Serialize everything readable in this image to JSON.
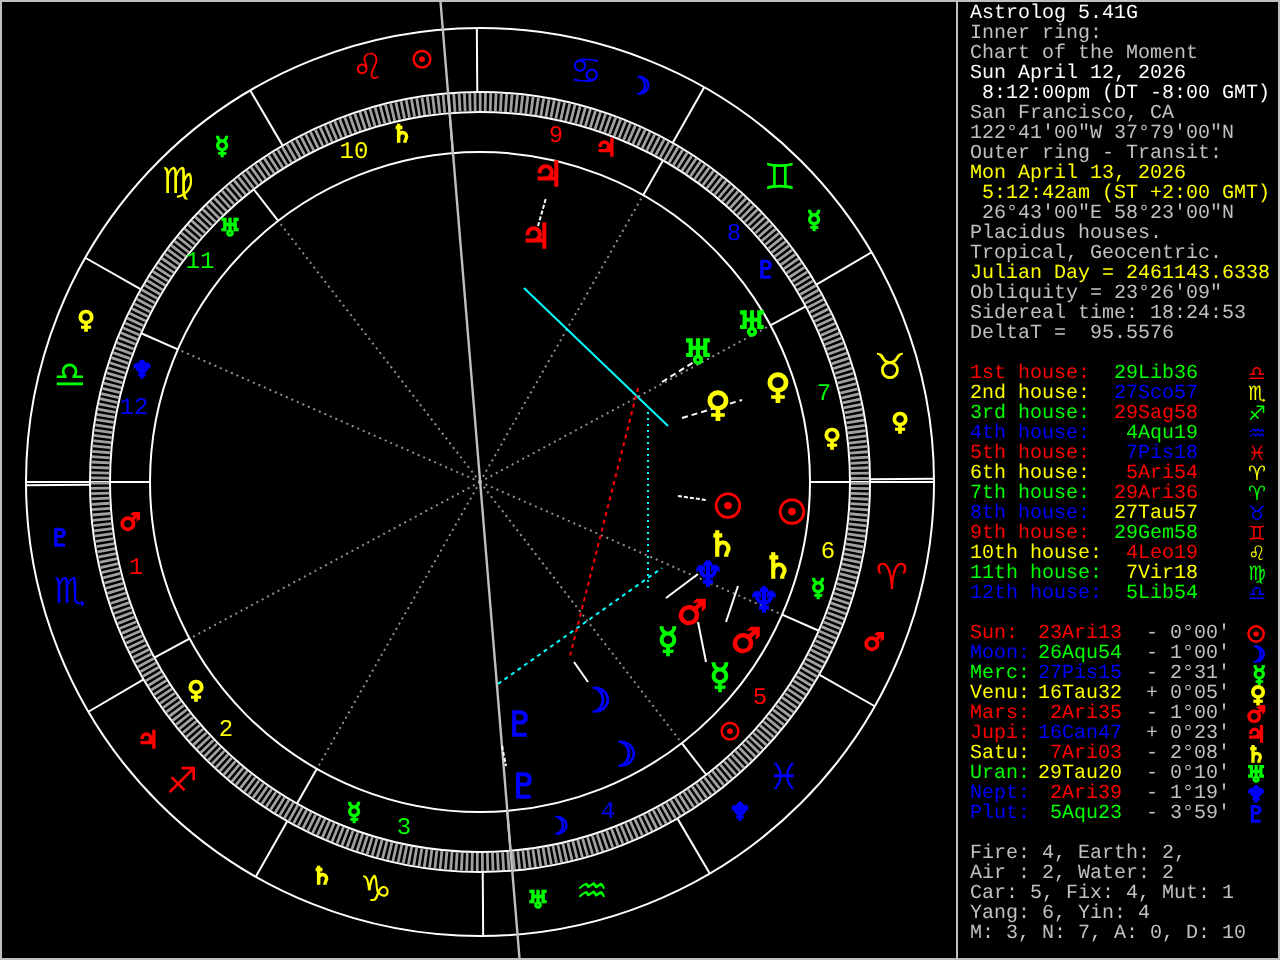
{
  "chart": {
    "house_numbers": [
      {
        "label": "1",
        "color": "#ff0000"
      },
      {
        "label": "2",
        "color": "#ffff00"
      },
      {
        "label": "3",
        "color": "#00ff00"
      },
      {
        "label": "4",
        "color": "#0000ff"
      },
      {
        "label": "5",
        "color": "#ff0000"
      },
      {
        "label": "6",
        "color": "#ffff00"
      },
      {
        "label": "7",
        "color": "#00ff00"
      },
      {
        "label": "8",
        "color": "#0000ff"
      },
      {
        "label": "9",
        "color": "#ff0000"
      },
      {
        "label": "10",
        "color": "#ffff00"
      },
      {
        "label": "11",
        "color": "#00ff00"
      },
      {
        "label": "12",
        "color": "#0000ff"
      }
    ],
    "sign_glyphs": [
      {
        "glyph": "♈",
        "color": "#ff0000"
      },
      {
        "glyph": "♉",
        "color": "#ffff00"
      },
      {
        "glyph": "♊",
        "color": "#00ff00"
      },
      {
        "glyph": "♋",
        "color": "#0000ff"
      },
      {
        "glyph": "♌",
        "color": "#ff0000"
      },
      {
        "glyph": "♍",
        "color": "#ffff00"
      },
      {
        "glyph": "♎",
        "color": "#00ff00"
      },
      {
        "glyph": "♏",
        "color": "#0000ff"
      },
      {
        "glyph": "♐",
        "color": "#ff0000"
      },
      {
        "glyph": "♑",
        "color": "#ffff00"
      },
      {
        "glyph": "♒",
        "color": "#00ff00"
      },
      {
        "glyph": "♓",
        "color": "#0000ff"
      }
    ],
    "planet_glyphs": [
      {
        "glyph": "☉",
        "color": "#ff0000"
      },
      {
        "glyph": "☿",
        "color": "#00ff00"
      },
      {
        "glyph": "♀",
        "color": "#ffff00"
      },
      {
        "glyph": "☽",
        "color": "#0000ff"
      },
      {
        "glyph": "☿",
        "color": "#00ff00"
      },
      {
        "glyph": "♀",
        "color": "#ffff00"
      },
      {
        "glyph": "♂",
        "color": "#ff0000"
      },
      {
        "glyph": "♇",
        "color": "#0000ff"
      },
      {
        "glyph": "♃",
        "color": "#ff0000"
      },
      {
        "glyph": "♄",
        "color": "#ffff00"
      },
      {
        "glyph": "♅",
        "color": "#00ff00"
      },
      {
        "glyph": "♆",
        "color": "#0000ff"
      },
      {
        "glyph": "♂",
        "color": "#ff0000"
      },
      {
        "glyph": "♄",
        "color": "#ffff00"
      },
      {
        "glyph": "♅",
        "color": "#00ff00"
      },
      {
        "glyph": "♆",
        "color": "#0000ff"
      },
      {
        "glyph": "♃",
        "color": "#ff0000"
      },
      {
        "glyph": "♇",
        "color": "#0000ff"
      },
      {
        "glyph": "♀",
        "color": "#ffff00"
      },
      {
        "glyph": "♀",
        "color": "#ffff00"
      },
      {
        "glyph": "☿",
        "color": "#00ff00"
      },
      {
        "glyph": "☽",
        "color": "#0000ff"
      },
      {
        "glyph": "☉",
        "color": "#ff0000"
      },
      {
        "glyph": "☿",
        "color": "#00ff00"
      },
      {
        "glyph": "♃",
        "color": "#ff0000"
      },
      {
        "glyph": "♃",
        "color": "#ff0000"
      },
      {
        "glyph": "♅",
        "color": "#00ff00"
      },
      {
        "glyph": "♅",
        "color": "#00ff00"
      },
      {
        "glyph": "♀",
        "color": "#ffff00"
      },
      {
        "glyph": "♀",
        "color": "#ffff00"
      },
      {
        "glyph": "☉",
        "color": "#ff0000"
      },
      {
        "glyph": "☉",
        "color": "#ff0000"
      },
      {
        "glyph": "♄",
        "color": "#ffff00"
      },
      {
        "glyph": "♄",
        "color": "#ffff00"
      },
      {
        "glyph": "♆",
        "color": "#0000ff"
      },
      {
        "glyph": "♆",
        "color": "#0000ff"
      },
      {
        "glyph": "♂",
        "color": "#ff0000"
      },
      {
        "glyph": "☿",
        "color": "#00ff00"
      },
      {
        "glyph": "♂",
        "color": "#ff0000"
      },
      {
        "glyph": "☿",
        "color": "#00ff00"
      },
      {
        "glyph": "☽",
        "color": "#0000ff"
      },
      {
        "glyph": "☽",
        "color": "#0000ff"
      },
      {
        "glyph": "♇",
        "color": "#0000ff"
      },
      {
        "glyph": "♇",
        "color": "#0000ff"
      }
    ]
  },
  "info_lines": [
    {
      "text": "Astrolog 5.41G",
      "color": "#ffffff"
    },
    {
      "text": "Inner ring:",
      "color": "#c0c0c0"
    },
    {
      "text": "Chart of the Moment",
      "color": "#c0c0c0"
    },
    {
      "text": "Sun April 12, 2026",
      "color": "#ffffff"
    },
    {
      "text": " 8:12:00pm (DT -8:00 GMT)",
      "color": "#ffffff"
    },
    {
      "text": "San Francisco, CA",
      "color": "#c0c0c0"
    },
    {
      "text": "122°41'00\"W 37°79'00\"N",
      "color": "#c0c0c0"
    },
    {
      "text": "Outer ring - Transit:",
      "color": "#c0c0c0"
    },
    {
      "text": "Mon April 13, 2026",
      "color": "#ffff00"
    },
    {
      "text": " 5:12:42am (ST +2:00 GMT)",
      "color": "#ffff00"
    },
    {
      "text": " 26°43'00\"E 58°23'00\"N",
      "color": "#c0c0c0"
    },
    {
      "text": "Placidus houses.",
      "color": "#c0c0c0"
    },
    {
      "text": "Tropical, Geocentric.",
      "color": "#c0c0c0"
    },
    {
      "text": "Julian Day = 2461143.6338",
      "color": "#ffff00"
    },
    {
      "text": "Obliquity = 23°26'09\"",
      "color": "#c0c0c0"
    },
    {
      "text": "Sidereal time: 18:24:53",
      "color": "#c0c0c0"
    },
    {
      "text": "DeltaT =  95.5576",
      "color": "#c0c0c0"
    }
  ],
  "houses": [
    {
      "label": {
        "text": "1st house:",
        "color": "#ff0000"
      },
      "position": {
        "text": "29Lib36",
        "color": "#00ff00"
      },
      "glyph": {
        "text": "♎",
        "color": "#ff0000"
      }
    },
    {
      "label": {
        "text": "2nd house:",
        "color": "#ffff00"
      },
      "position": {
        "text": "27Sco57",
        "color": "#0000ff"
      },
      "glyph": {
        "text": "♏",
        "color": "#ffff00"
      }
    },
    {
      "label": {
        "text": "3rd house:",
        "color": "#00ff00"
      },
      "position": {
        "text": "29Sag58",
        "color": "#ff0000"
      },
      "glyph": {
        "text": "♐",
        "color": "#00ff00"
      }
    },
    {
      "label": {
        "text": "4th house:",
        "color": "#0000ff"
      },
      "position": {
        "text": "4Aqu19",
        "color": "#00ff00"
      },
      "glyph": {
        "text": "♒",
        "color": "#0000ff"
      }
    },
    {
      "label": {
        "text": "5th house:",
        "color": "#ff0000"
      },
      "position": {
        "text": "7Pis18",
        "color": "#0000ff"
      },
      "glyph": {
        "text": "♓",
        "color": "#ff0000"
      }
    },
    {
      "label": {
        "text": "6th house:",
        "color": "#ffff00"
      },
      "position": {
        "text": "5Ari54",
        "color": "#ff0000"
      },
      "glyph": {
        "text": "♈",
        "color": "#ffff00"
      }
    },
    {
      "label": {
        "text": "7th house:",
        "color": "#00ff00"
      },
      "position": {
        "text": "29Ari36",
        "color": "#ff0000"
      },
      "glyph": {
        "text": "♈",
        "color": "#00ff00"
      }
    },
    {
      "label": {
        "text": "8th house:",
        "color": "#0000ff"
      },
      "position": {
        "text": "27Tau57",
        "color": "#ffff00"
      },
      "glyph": {
        "text": "♉",
        "color": "#0000ff"
      }
    },
    {
      "label": {
        "text": "9th house:",
        "color": "#ff0000"
      },
      "position": {
        "text": "29Gem58",
        "color": "#00ff00"
      },
      "glyph": {
        "text": "♊",
        "color": "#ff0000"
      }
    },
    {
      "label": {
        "text": "10th house:",
        "color": "#ffff00"
      },
      "position": {
        "text": "4Leo19",
        "color": "#ff0000"
      },
      "glyph": {
        "text": "♌",
        "color": "#ffff00"
      }
    },
    {
      "label": {
        "text": "11th house:",
        "color": "#00ff00"
      },
      "position": {
        "text": "7Vir18",
        "color": "#ffff00"
      },
      "glyph": {
        "text": "♍",
        "color": "#00ff00"
      }
    },
    {
      "label": {
        "text": "12th house:",
        "color": "#0000ff"
      },
      "position": {
        "text": "5Lib54",
        "color": "#00ff00"
      },
      "glyph": {
        "text": "♎",
        "color": "#0000ff"
      }
    }
  ],
  "planets": [
    {
      "name": {
        "text": "Sun:",
        "color": "#ff0000"
      },
      "position": {
        "text": "23Ari13",
        "color": "#ff0000"
      },
      "motion": "- 0°00'",
      "glyph": {
        "text": "☉",
        "color": "#ff0000"
      }
    },
    {
      "name": {
        "text": "Moon:",
        "color": "#0000ff"
      },
      "position": {
        "text": "26Aqu54",
        "color": "#00ff00"
      },
      "motion": "- 1°00'",
      "glyph": {
        "text": "☽",
        "color": "#0000ff"
      }
    },
    {
      "name": {
        "text": "Merc:",
        "color": "#00ff00"
      },
      "position": {
        "text": "27Pis15",
        "color": "#0000ff"
      },
      "motion": "- 2°31'",
      "glyph": {
        "text": "☿",
        "color": "#00ff00"
      }
    },
    {
      "name": {
        "text": "Venu:",
        "color": "#ffff00"
      },
      "position": {
        "text": "16Tau32",
        "color": "#ffff00"
      },
      "motion": "+ 0°05'",
      "glyph": {
        "text": "♀",
        "color": "#ffff00"
      }
    },
    {
      "name": {
        "text": "Mars:",
        "color": "#ff0000"
      },
      "position": {
        "text": "2Ari35",
        "color": "#ff0000"
      },
      "motion": "- 1°00'",
      "glyph": {
        "text": "♂",
        "color": "#ff0000"
      }
    },
    {
      "name": {
        "text": "Jupi:",
        "color": "#ff0000"
      },
      "position": {
        "text": "16Can47",
        "color": "#0000ff"
      },
      "motion": "+ 0°23'",
      "glyph": {
        "text": "♃",
        "color": "#ff0000"
      }
    },
    {
      "name": {
        "text": "Satu:",
        "color": "#ffff00"
      },
      "position": {
        "text": "7Ari03",
        "color": "#ff0000"
      },
      "motion": "- 2°08'",
      "glyph": {
        "text": "♄",
        "color": "#ffff00"
      }
    },
    {
      "name": {
        "text": "Uran:",
        "color": "#00ff00"
      },
      "position": {
        "text": "29Tau20",
        "color": "#ffff00"
      },
      "motion": "- 0°10'",
      "glyph": {
        "text": "♅",
        "color": "#00ff00"
      }
    },
    {
      "name": {
        "text": "Nept:",
        "color": "#0000ff"
      },
      "position": {
        "text": "2Ari39",
        "color": "#ff0000"
      },
      "motion": "- 1°19'",
      "glyph": {
        "text": "♆",
        "color": "#0000ff"
      }
    },
    {
      "name": {
        "text": "Plut:",
        "color": "#0000ff"
      },
      "position": {
        "text": "5Aqu23",
        "color": "#00ff00"
      },
      "motion": "- 3°59'",
      "glyph": {
        "text": "♇",
        "color": "#0000ff"
      }
    }
  ],
  "summary": [
    "Fire: 4, Earth: 2,",
    "Air : 2, Water: 2",
    "Car: 5, Fix: 4, Mut: 1",
    "Yang: 6, Yin: 4",
    "M: 3, N: 7, A: 0, D: 10"
  ]
}
